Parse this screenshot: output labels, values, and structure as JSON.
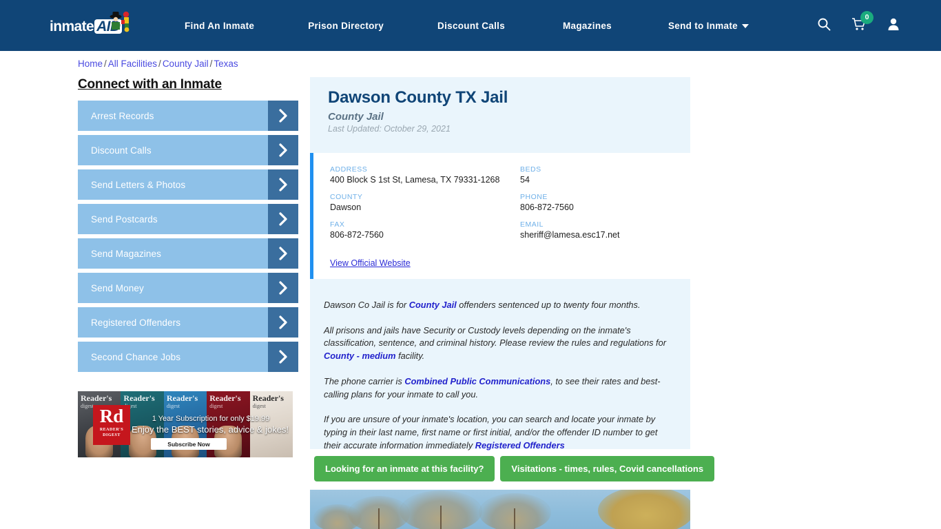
{
  "header": {
    "logo_text_1": "inmate",
    "logo_text_2": "AID",
    "nav_items": [
      {
        "label": "Find An Inmate"
      },
      {
        "label": "Prison Directory"
      },
      {
        "label": "Discount Calls"
      },
      {
        "label": "Magazines"
      },
      {
        "label": "Send to Inmate",
        "has_caret": true
      }
    ],
    "cart_count": "0",
    "brand_color": "#104577"
  },
  "breadcrumb": {
    "items": [
      "Home",
      "All Facilities",
      "County Jail",
      "Texas"
    ],
    "separator": "/"
  },
  "sidebar": {
    "title": "Connect with an Inmate",
    "items": [
      {
        "label": "Arrest Records"
      },
      {
        "label": "Discount Calls"
      },
      {
        "label": "Send Letters & Photos"
      },
      {
        "label": "Send Postcards"
      },
      {
        "label": "Send Magazines"
      },
      {
        "label": "Send Money"
      },
      {
        "label": "Registered Offenders"
      },
      {
        "label": "Second Chance Jobs"
      }
    ],
    "item_color": "#8ec1e8",
    "arrow_color": "#3a6e9e"
  },
  "ad": {
    "brand_mark_big": "Rd",
    "brand_mark_line1": "READER'S",
    "brand_mark_line2": "DIGEST",
    "headline": "1 Year Subscription for only $19.99",
    "subhead": "Enjoy the BEST stories, advice & jokes!",
    "cta": "Subscribe Now",
    "covers": [
      {
        "title": "Reader's",
        "sub": "digest"
      },
      {
        "title": "Reader's",
        "sub": "digest"
      },
      {
        "title": "Reader's",
        "sub": "digest"
      },
      {
        "title": "Reader's",
        "sub": "digest"
      },
      {
        "title": "Reader's",
        "sub": "digest"
      }
    ]
  },
  "facility": {
    "name": "Dawson County TX Jail",
    "type": "County Jail",
    "last_updated": "Last Updated: October 29, 2021",
    "fields": [
      {
        "label": "ADDRESS",
        "value": "400 Block S 1st St, Lamesa, TX 79331-1268"
      },
      {
        "label": "BEDS",
        "value": "54"
      },
      {
        "label": "COUNTY",
        "value": "Dawson"
      },
      {
        "label": "PHONE",
        "value": "806-872-7560"
      },
      {
        "label": "FAX",
        "value": "806-872-7560"
      },
      {
        "label": "EMAIL",
        "value": "sheriff@lamesa.esc17.net"
      }
    ],
    "official_website_link": "View Official Website",
    "accent_color": "#1f90f0",
    "panel_color": "#eaf5fc"
  },
  "description": {
    "p1_a": "Dawson Co Jail is for ",
    "p1_link": "County Jail",
    "p1_b": " offenders sentenced up to twenty four months.",
    "p2_a": "All prisons and jails have Security or Custody levels depending on the inmate's classification, sentence, and criminal history. Please review the rules and regulations for ",
    "p2_link": "County - medium",
    "p2_b": " facility.",
    "p3_a": "The phone carrier is ",
    "p3_link": "Combined Public Communications",
    "p3_b": ", to see their rates and best-calling plans for your inmate to call you.",
    "p4_a": "If you are unsure of your inmate's location, you can search and locate your inmate by typing in their last name, first name or first initial, and/or the offender ID number to get their accurate information immediately ",
    "p4_link": "Registered Offenders"
  },
  "cta_buttons": [
    {
      "label": "Looking for an inmate at this facility?"
    },
    {
      "label": "Visitations - times, rules, Covid cancellations"
    }
  ],
  "cta_color": "#4caf50"
}
